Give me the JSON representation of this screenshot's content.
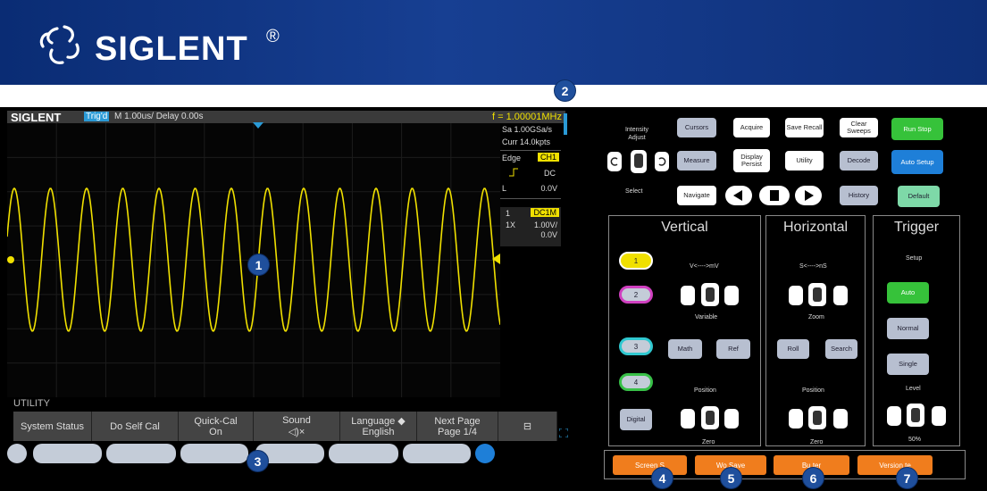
{
  "header": {
    "brand": "SIGLENT",
    "reg_mark": "®"
  },
  "scope": {
    "brand": "SIGLENT",
    "trigger_status": "Trig'd",
    "timebase": "M 1.00us/  Delay 0.00s",
    "frequency": "f = 1.00001MHz",
    "sample_rate": "Sa 1.00GSa/s",
    "memory_depth": "Curr 14.0kpts",
    "trigger": {
      "type": "Edge",
      "source": "CH1",
      "coupling": "DC",
      "level_label": "L",
      "level": "0.0V"
    },
    "channel": {
      "number": "1",
      "coupling": "DC1M",
      "probe": "1X",
      "scale": "1.00V/",
      "offset": "0.0V"
    },
    "softkeys_title": "UTILITY",
    "softkeys": [
      {
        "line1": "System Status",
        "line2": ""
      },
      {
        "line1": "Do Self Cal",
        "line2": ""
      },
      {
        "line1": "Quick-Cal",
        "line2": "On"
      },
      {
        "line1": "Sound",
        "line2": "◁)×"
      },
      {
        "line1": "Language ◆",
        "line2": "English"
      },
      {
        "line1": "Next Page",
        "line2": "Page 1/4"
      },
      {
        "line1": "⊟",
        "line2": ""
      }
    ]
  },
  "callouts": [
    "1",
    "2",
    "3",
    "4",
    "5",
    "6",
    "7"
  ],
  "panel": {
    "intensity_label": "Intensity Adjust",
    "select_label": "Select",
    "buttons": {
      "cursors": "Cursors",
      "acquire": "Acquire",
      "save_recall": "Save Recall",
      "clear_sweeps": "Clear Sweeps",
      "run_stop": "Run Stop",
      "measure": "Measure",
      "display_persist": "Display Persist",
      "utility": "Utility",
      "decode": "Decode",
      "auto_setup": "Auto Setup",
      "navigate": "Navigate",
      "history": "History",
      "default": "Default"
    },
    "vertical": {
      "title": "Vertical",
      "scale_label": "V<---->mV",
      "variable": "Variable",
      "math": "Math",
      "ref": "Ref",
      "position": "Position",
      "zero": "Zero",
      "ch1": "1",
      "ch2": "2",
      "ch3": "3",
      "ch4": "4",
      "digital": "Digital"
    },
    "horizontal": {
      "title": "Horizontal",
      "scale_label": "S<---->nS",
      "zoom": "Zoom",
      "roll": "Roll",
      "search": "Search",
      "position": "Position",
      "zero": "Zero"
    },
    "trigger": {
      "title": "Trigger",
      "setup": "Setup",
      "auto": "Auto",
      "normal": "Normal",
      "single": "Single",
      "level": "Level",
      "percent": "50%"
    },
    "bottom_buttons": [
      "Screen S",
      "Wo    Save",
      "Bu   ter",
      "Version    te"
    ]
  },
  "colors": {
    "banner": "#173f92",
    "waveform": "#f0e000",
    "accent_blue": "#2a9ad6",
    "run_green": "#36c23a",
    "orange": "#f07d1d"
  }
}
